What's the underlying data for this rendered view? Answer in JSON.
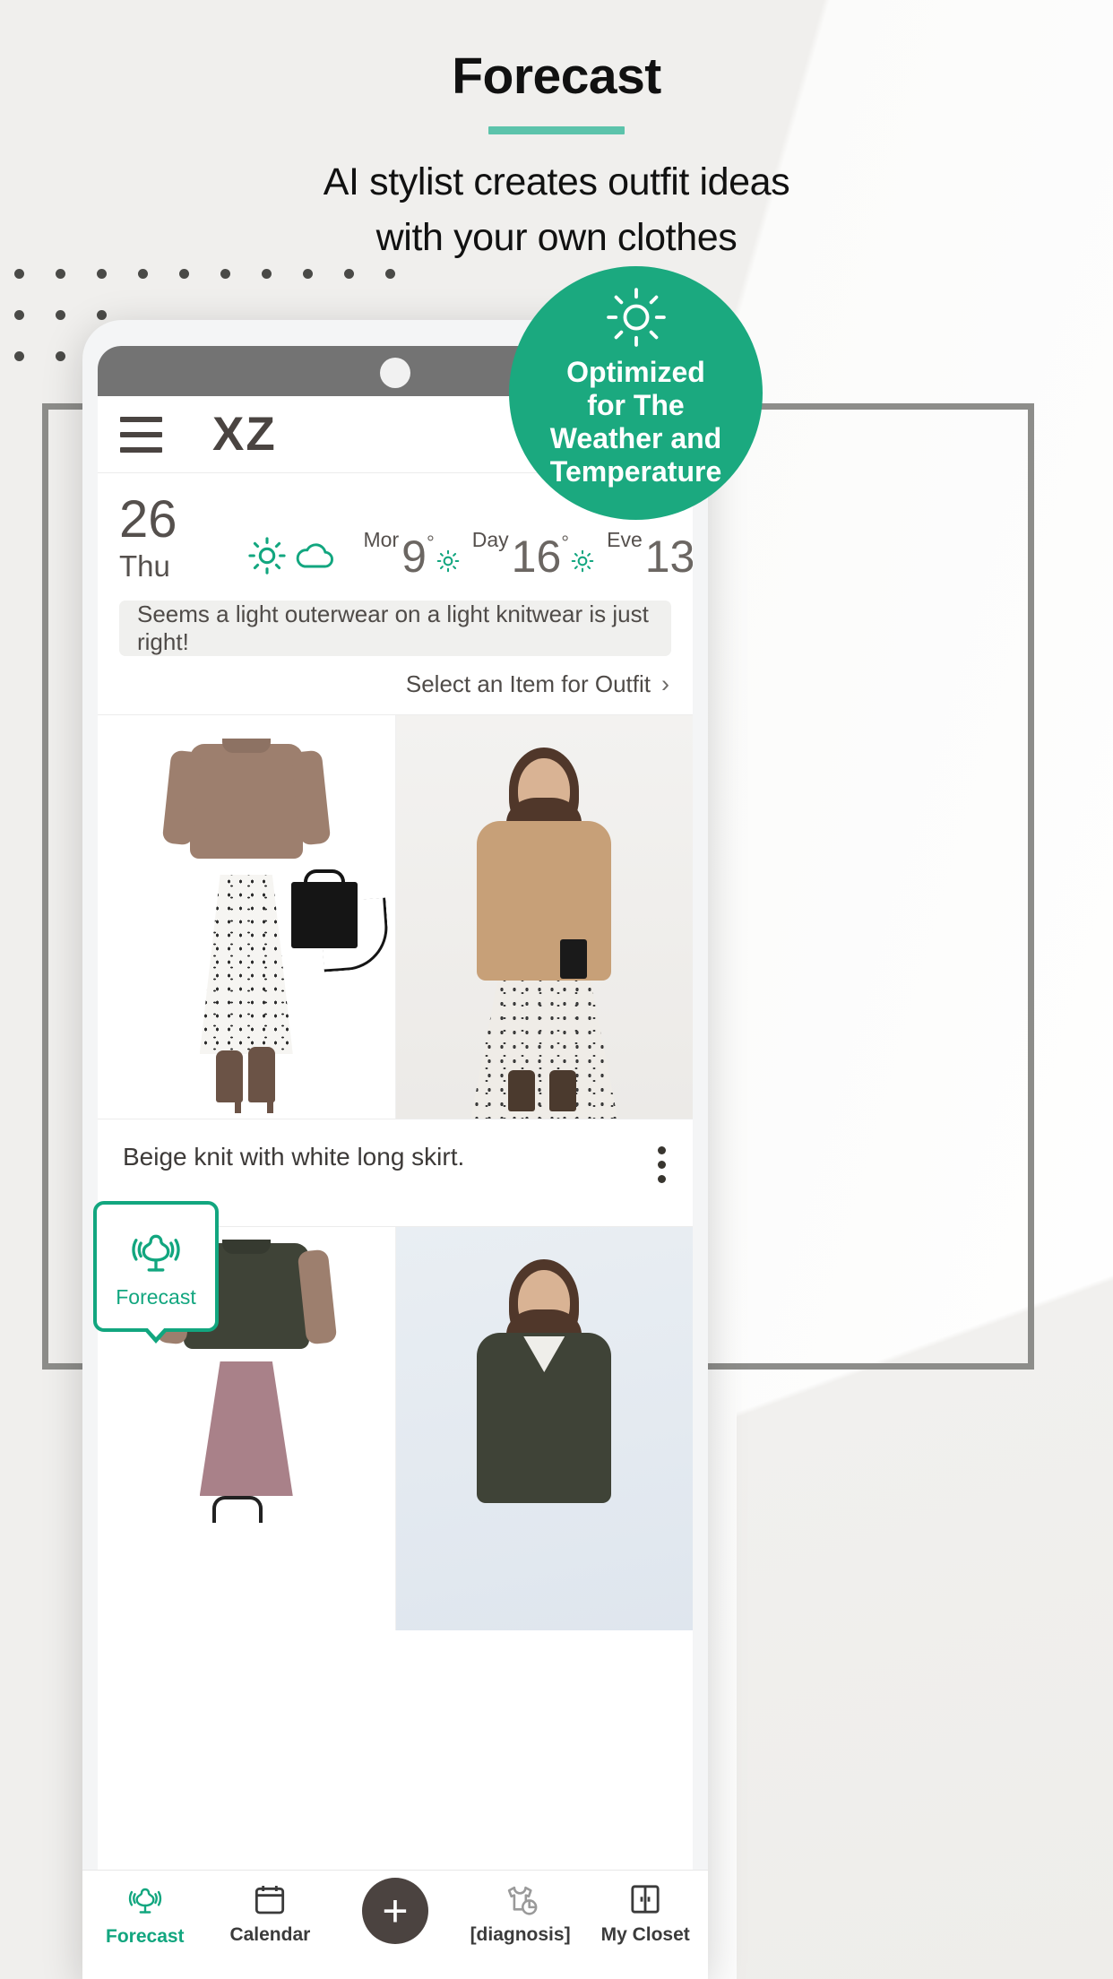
{
  "promo": {
    "headline": "Forecast",
    "subhead_line1": "AI stylist creates outfit ideas",
    "subhead_line2": "with your own clothes",
    "accent_color": "#5cc3ab"
  },
  "badge": {
    "icon": "sun-icon",
    "line1": "Optimized",
    "line2": "for The",
    "line3": "Weather and",
    "line4": "Temperature",
    "background_color": "#1ba97f"
  },
  "app": {
    "menu_icon": "hamburger-menu-icon",
    "brand": "XZ",
    "weather": {
      "day_number": "26",
      "day_of_week": "Thu",
      "condition_icons": [
        "sun-icon",
        "cloud-icon"
      ],
      "slots": [
        {
          "label": "Mor",
          "temp": "9",
          "degree": "°",
          "icon": "sun-icon"
        },
        {
          "label": "Day",
          "temp": "16",
          "degree": "°",
          "icon": "sun-icon"
        },
        {
          "label": "Eve",
          "temp": "13",
          "degree": "°",
          "icon": "cloud-icon"
        }
      ]
    },
    "advice": "Seems a light outerwear on a light knitwear is just right!",
    "select_item": "Select an Item for Outfit",
    "select_chevron": "›",
    "outfits": [
      {
        "caption": "Beige knit with white long skirt.",
        "menu_icon": "kebab-menu-icon"
      },
      {
        "caption": "",
        "menu_icon": "kebab-menu-icon"
      }
    ],
    "tooltip": {
      "icon": "mannequin-icon",
      "label": "Forecast"
    },
    "tabs": [
      {
        "id": "forecast",
        "label": "Forecast",
        "icon": "mannequin-icon",
        "active": true
      },
      {
        "id": "calendar",
        "label": "Calendar",
        "icon": "calendar-icon",
        "active": false
      },
      {
        "id": "add",
        "label": "",
        "icon": "plus-icon",
        "active": false
      },
      {
        "id": "diagnosis",
        "label": "[diagnosis]",
        "icon": "tshirt-chart-icon",
        "active": false
      },
      {
        "id": "closet",
        "label": "My Closet",
        "icon": "closet-icon",
        "active": false
      }
    ]
  }
}
